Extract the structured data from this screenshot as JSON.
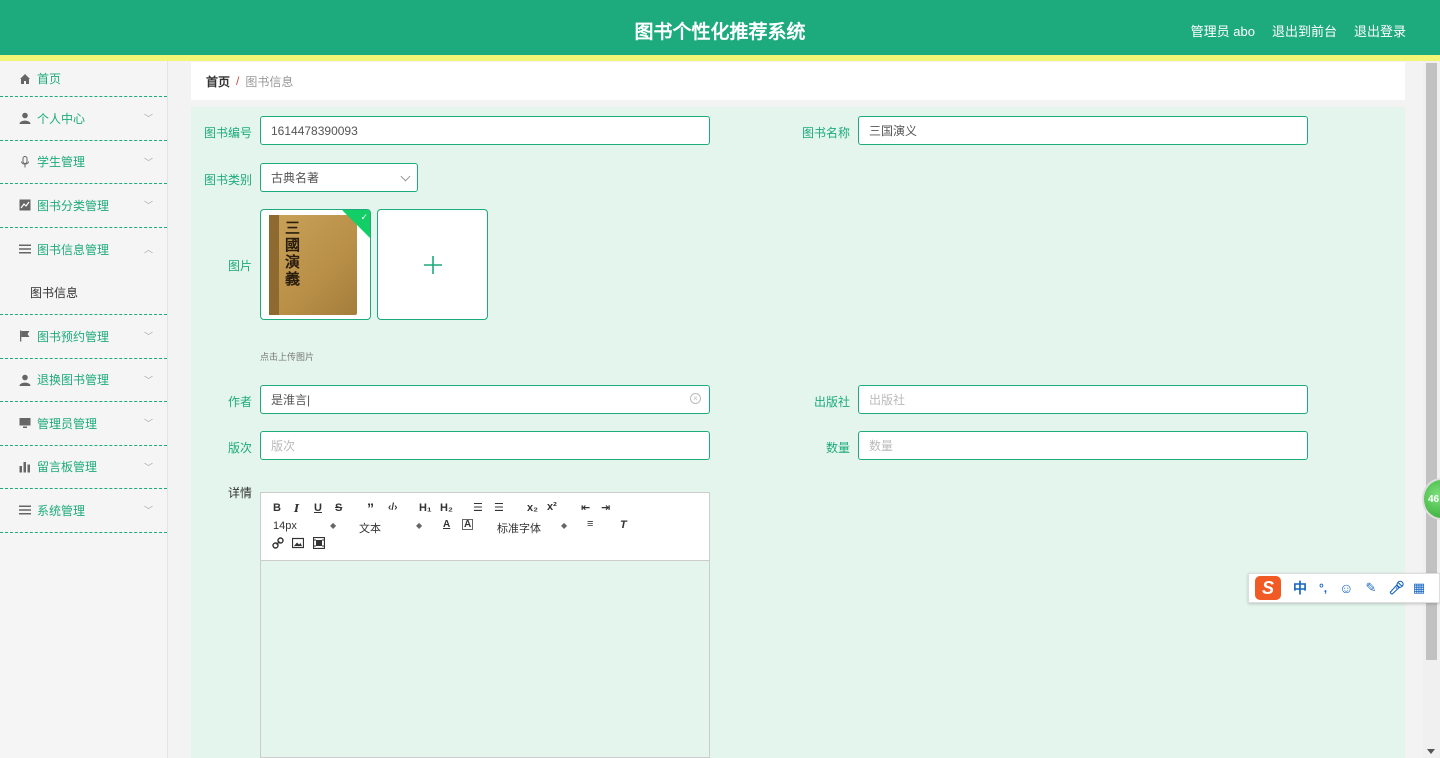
{
  "header": {
    "title": "图书个性化推荐系统",
    "links": [
      "管理员 abo",
      "退出到前台",
      "退出登录"
    ]
  },
  "sidebar": {
    "items": [
      {
        "label": "首页",
        "icon": "home-icon"
      },
      {
        "label": "个人中心",
        "icon": "user-icon"
      },
      {
        "label": "学生管理",
        "icon": "mic-icon"
      },
      {
        "label": "图书分类管理",
        "icon": "chart-icon"
      },
      {
        "label": "图书信息管理",
        "icon": "list-icon"
      },
      {
        "label": "图书预约管理",
        "icon": "flag-icon"
      },
      {
        "label": "退换图书管理",
        "icon": "user-icon"
      },
      {
        "label": "管理员管理",
        "icon": "monitor-icon"
      },
      {
        "label": "留言板管理",
        "icon": "bar-chart-icon"
      },
      {
        "label": "系统管理",
        "icon": "list-icon"
      }
    ],
    "subitem": "图书信息"
  },
  "breadcrumb": {
    "home": "首页",
    "separator": "/",
    "current": "图书信息"
  },
  "form": {
    "book_no_label": "图书编号",
    "book_no_value": "1614478390093",
    "book_name_label": "图书名称",
    "book_name_value": "三国演义",
    "category_label": "图书类别",
    "category_value": "古典名著",
    "image_label": "图片",
    "upload_hint": "点击上传图片",
    "book_cover_text": "三國演義",
    "author_label": "作者",
    "author_value": "是淮言|",
    "publisher_label": "出版社",
    "publisher_placeholder": "出版社",
    "edition_label": "版次",
    "edition_placeholder": "版次",
    "quantity_label": "数量",
    "quantity_placeholder": "数量",
    "details_label": "详情"
  },
  "editor_toolbar": {
    "font_size": "14px",
    "text_type": "文本",
    "font_family": "标准字体"
  },
  "float_badge": "46",
  "ime": {
    "logo": "S",
    "mode": "中"
  },
  "colors": {
    "primary": "#1daa7c",
    "stripe": "#f3f576",
    "panel": "#e4f5ee"
  }
}
